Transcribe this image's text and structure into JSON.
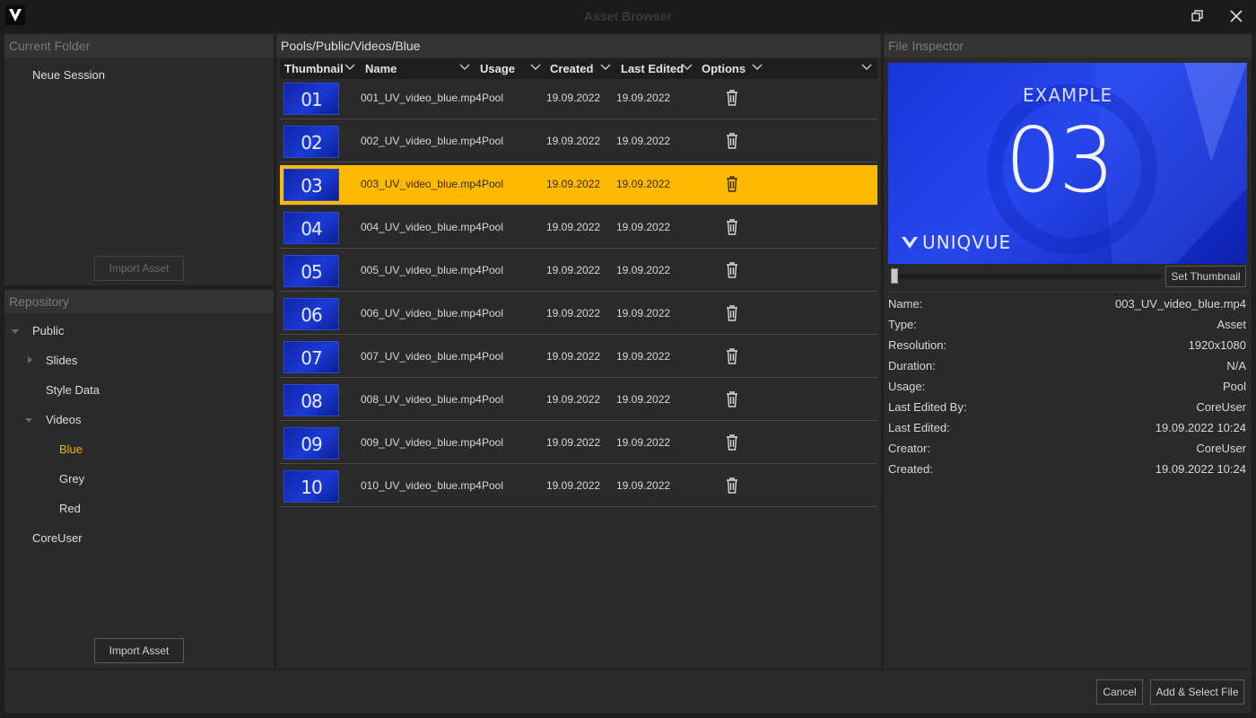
{
  "window": {
    "title": "Asset Browser"
  },
  "current_folder": {
    "header": "Current Folder",
    "item": "Neue Session",
    "import_label": "Import Asset"
  },
  "repository": {
    "header": "Repository",
    "items": [
      {
        "label": "Public",
        "expanded": true
      },
      {
        "label": "Slides",
        "expanded": false
      },
      {
        "label": "Style Data"
      },
      {
        "label": "Videos",
        "expanded": true
      },
      {
        "label": "Blue",
        "active": true
      },
      {
        "label": "Grey"
      },
      {
        "label": "Red"
      },
      {
        "label": "CoreUser"
      }
    ],
    "import_label": "Import Asset"
  },
  "browser": {
    "path": "Pools/Public/Videos/Blue",
    "columns": [
      "Thumbnail",
      "Name",
      "Usage",
      "Created",
      "Last Edited",
      "Options"
    ],
    "selected_index": 2,
    "rows": [
      {
        "thumb": "01",
        "name": "001_UV_video_blue.mp4",
        "usage": "Pool",
        "created": "19.09.2022",
        "edited": "19.09.2022"
      },
      {
        "thumb": "02",
        "name": "002_UV_video_blue.mp4",
        "usage": "Pool",
        "created": "19.09.2022",
        "edited": "19.09.2022"
      },
      {
        "thumb": "03",
        "name": "003_UV_video_blue.mp4",
        "usage": "Pool",
        "created": "19.09.2022",
        "edited": "19.09.2022"
      },
      {
        "thumb": "04",
        "name": "004_UV_video_blue.mp4",
        "usage": "Pool",
        "created": "19.09.2022",
        "edited": "19.09.2022"
      },
      {
        "thumb": "05",
        "name": "005_UV_video_blue.mp4",
        "usage": "Pool",
        "created": "19.09.2022",
        "edited": "19.09.2022"
      },
      {
        "thumb": "06",
        "name": "006_UV_video_blue.mp4",
        "usage": "Pool",
        "created": "19.09.2022",
        "edited": "19.09.2022"
      },
      {
        "thumb": "07",
        "name": "007_UV_video_blue.mp4",
        "usage": "Pool",
        "created": "19.09.2022",
        "edited": "19.09.2022"
      },
      {
        "thumb": "08",
        "name": "008_UV_video_blue.mp4",
        "usage": "Pool",
        "created": "19.09.2022",
        "edited": "19.09.2022"
      },
      {
        "thumb": "09",
        "name": "009_UV_video_blue.mp4",
        "usage": "Pool",
        "created": "19.09.2022",
        "edited": "19.09.2022"
      },
      {
        "thumb": "10",
        "name": "010_UV_video_blue.mp4",
        "usage": "Pool",
        "created": "19.09.2022",
        "edited": "19.09.2022"
      }
    ]
  },
  "inspector": {
    "header": "File Inspector",
    "preview": {
      "example": "EXAMPLE",
      "number": "03",
      "brand": "UNIQVUE"
    },
    "set_thumbnail_label": "Set Thumbnail",
    "fields": [
      {
        "label": "Name:",
        "value": "003_UV_video_blue.mp4"
      },
      {
        "label": "Type:",
        "value": "Asset"
      },
      {
        "label": "Resolution:",
        "value": "1920x1080"
      },
      {
        "label": "Duration:",
        "value": "N/A"
      },
      {
        "label": "Usage:",
        "value": "Pool"
      },
      {
        "label": "Last Edited By:",
        "value": "CoreUser"
      },
      {
        "label": "Last Edited:",
        "value": "19.09.2022 10:24"
      },
      {
        "label": "Creator:",
        "value": "CoreUser"
      },
      {
        "label": "Created:",
        "value": "19.09.2022 10:24"
      }
    ]
  },
  "footer": {
    "cancel_label": "Cancel",
    "add_select_label": "Add & Select File"
  },
  "colors": {
    "accent": "#ffba00",
    "background": "#1f1f1f",
    "panel": "#2a2a2a",
    "thumbnail_blue": "#1b3bd6"
  }
}
